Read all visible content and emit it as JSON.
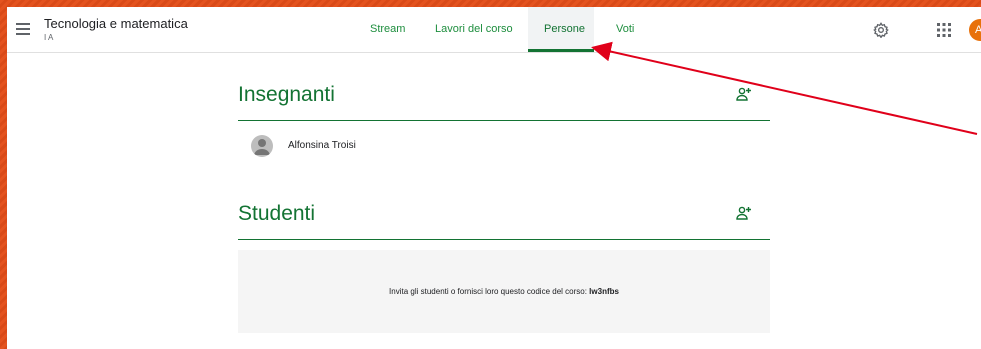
{
  "header": {
    "class_title": "Tecnologia e matematica",
    "class_section": "I A",
    "tabs": [
      {
        "label": "Stream"
      },
      {
        "label": "Lavori del corso"
      },
      {
        "label": "Persone"
      },
      {
        "label": "Voti"
      }
    ],
    "avatar_initial": "A"
  },
  "teachers": {
    "title": "Insegnanti",
    "items": [
      {
        "name": "Alfonsina Troisi"
      }
    ]
  },
  "students": {
    "title": "Studenti",
    "invite_text": "Invita gli studenti o fornisci loro questo codice del corso:",
    "class_code": "lw3nfbs"
  },
  "colors": {
    "accent": "#137333",
    "annotation_arrow": "#e0001a",
    "background": "#e4531f"
  }
}
